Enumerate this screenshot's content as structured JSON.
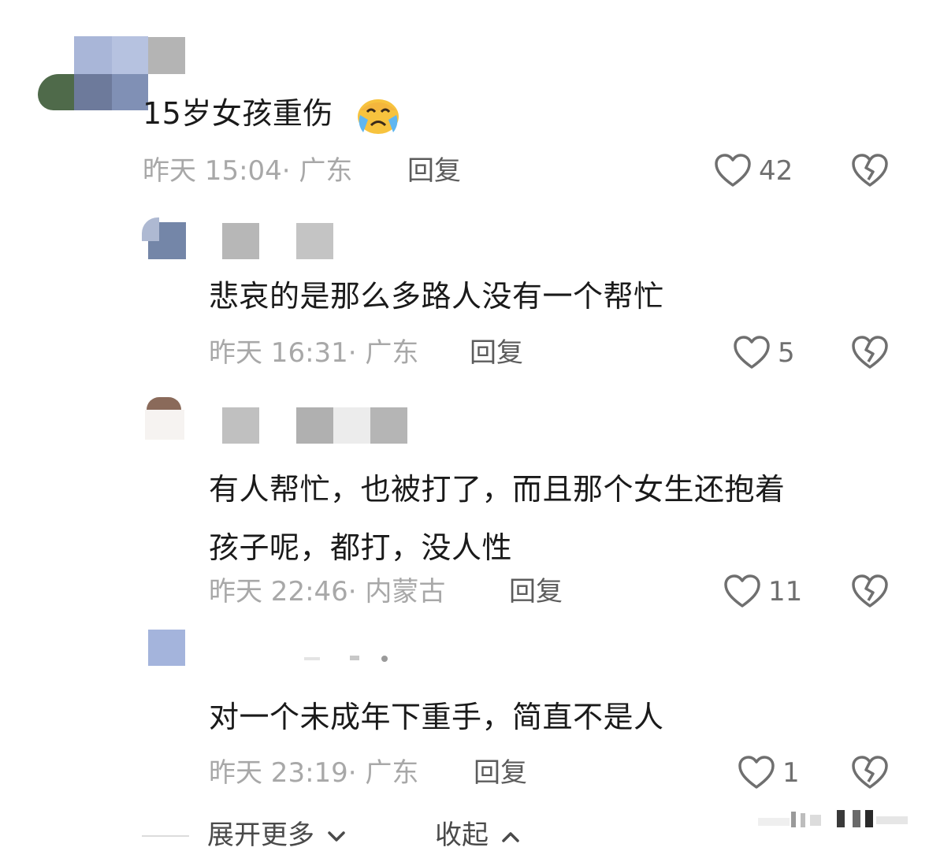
{
  "comments": [
    {
      "text": "15岁女孩重伤",
      "emoji": "crying-face",
      "time": "昨天 15:04·",
      "location": "广东",
      "reply_label": "回复",
      "likes": "42"
    },
    {
      "text": "悲哀的是那么多路人没有一个帮忙",
      "time": "昨天 16:31·",
      "location": "广东",
      "reply_label": "回复",
      "likes": "5"
    },
    {
      "text_line1": "有人帮忙，也被打了，而且那个女生还抱着",
      "text_line2": "孩子呢，都打，没人性",
      "time": "昨天 22:46·",
      "location": "内蒙古",
      "reply_label": "回复",
      "likes": "11"
    },
    {
      "text": "对一个未成年下重手，简直不是人",
      "time": "昨天 23:19·",
      "location": "广东",
      "reply_label": "回复",
      "likes": "1"
    }
  ],
  "footer": {
    "expand_label": "展开更多",
    "collapse_label": "收起"
  },
  "colors": {
    "meta_text": "#a8a8a8",
    "reply_text": "#5c5c5c",
    "icon_stroke": "#6f6f6f"
  }
}
